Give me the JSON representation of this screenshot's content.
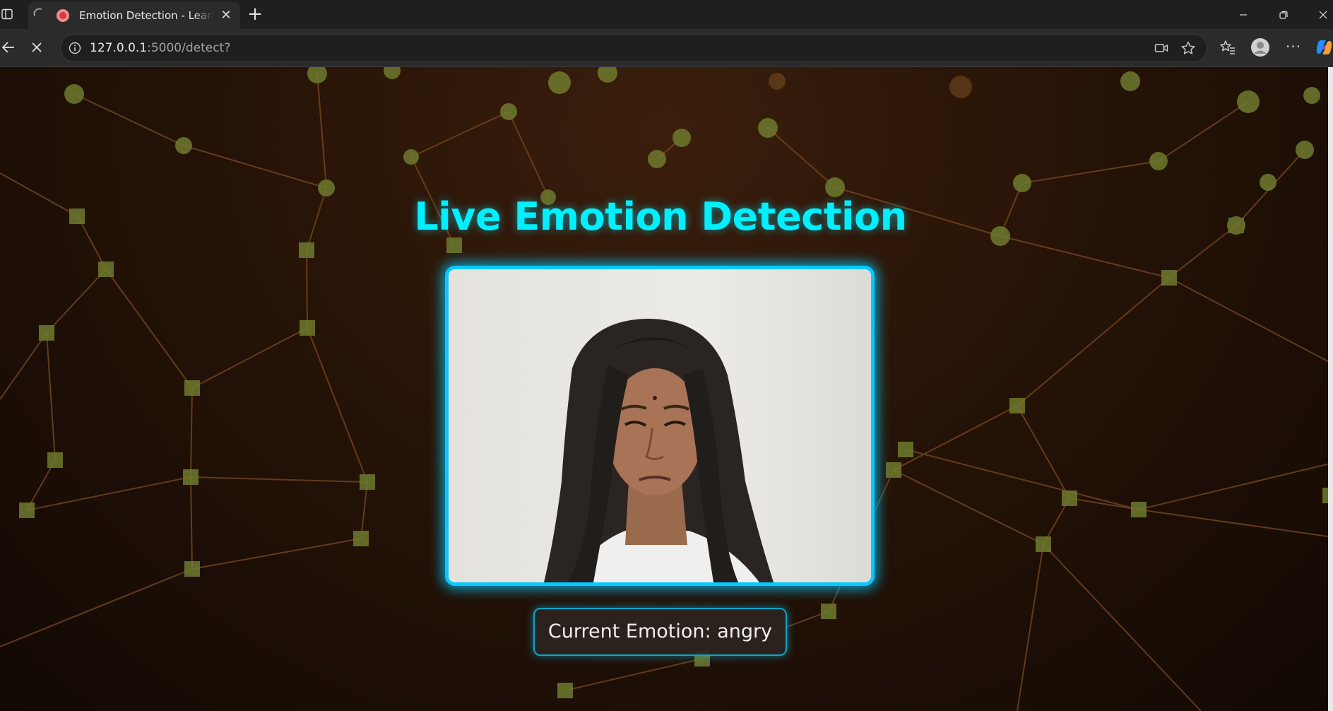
{
  "browser": {
    "tab": {
      "title": "Emotion Detection - Learnor"
    },
    "address": {
      "host": "127.0.0.1",
      "path": ":5000/detect?"
    }
  },
  "page": {
    "title": "Live Emotion Detection",
    "emotion_label": "Current Emotion: angry",
    "accent_color": "#00f0ff",
    "frame_border_color": "#08c8ff"
  },
  "icons": {
    "sidebar": "sidebar-icon",
    "favicon": "record-icon",
    "close": "close-icon",
    "new_tab": "plus-icon",
    "back": "arrow-left-icon",
    "stop": "stop-icon",
    "site_info": "info-icon",
    "camera": "camera-icon",
    "favorite": "star-icon",
    "favorites": "favorites-icon",
    "profile": "profile-icon",
    "more": "more-icon",
    "copilot": "copilot-icon"
  }
}
